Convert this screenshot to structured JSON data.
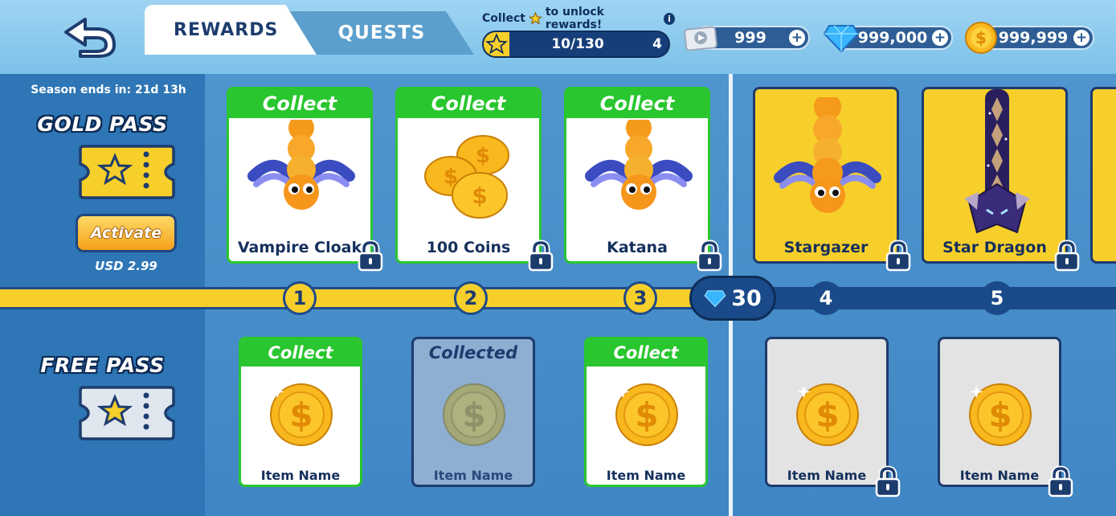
{
  "tabs": {
    "rewards": "REWARDS",
    "quests": "QUESTS"
  },
  "progress": {
    "hint_prefix": "Collect",
    "hint_suffix": "to unlock rewards!",
    "text": "10/130",
    "level": "4",
    "fraction": 0.077
  },
  "currencies": {
    "tickets": "999",
    "gems": "999,000",
    "coins": "999,999"
  },
  "season": "Season ends in: 21d 13h",
  "gold_pass": {
    "title": "GOLD PASS",
    "activate": "Activate",
    "price": "USD 2.99"
  },
  "free_pass": {
    "title": "FREE PASS"
  },
  "gold_rewards": [
    {
      "status": "Collect",
      "name": "Vampire Cloak",
      "type": "snake"
    },
    {
      "status": "Collect",
      "name": "100 Coins",
      "type": "coins"
    },
    {
      "status": "Collect",
      "name": "Katana",
      "type": "snake"
    },
    {
      "status": "",
      "name": "Stargazer",
      "type": "snake"
    },
    {
      "status": "",
      "name": "Star Dragon",
      "type": "dragon"
    }
  ],
  "free_rewards": [
    {
      "status": "Collect",
      "name": "Item Name"
    },
    {
      "status": "Collected",
      "name": "Item Name"
    },
    {
      "status": "Collect",
      "name": "Item Name"
    },
    {
      "status": "",
      "name": "Item Name"
    },
    {
      "status": "",
      "name": "Item Name"
    }
  ],
  "track": {
    "levels": [
      "1",
      "2",
      "3",
      "4",
      "5"
    ],
    "gem_bonus": "30"
  }
}
